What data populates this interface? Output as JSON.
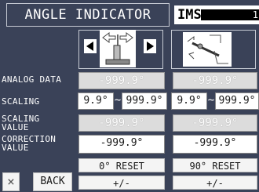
{
  "header": {
    "title": "ANGLE INDICATOR",
    "brand": "IMS",
    "brand_tail": "1"
  },
  "labels": {
    "analog_data": "ANALOG DATA",
    "scaling": "SCALING",
    "scaling_value_1": "SCALING",
    "scaling_value_2": "VALUE",
    "correction_value_1": "CORRECTION",
    "correction_value_2": "VALUE"
  },
  "left": {
    "analog_data": "-999.9°",
    "scaling_min": "9.9°",
    "scaling_sep": "~",
    "scaling_max": "999.9°",
    "scaling_value": "-999.9°",
    "correction_value": "-999.9°",
    "reset_label": "0° RESET",
    "sign_label": "+/-"
  },
  "right": {
    "analog_data": "-999.9°",
    "scaling_min": "9.9°",
    "scaling_sep": "~",
    "scaling_max": "999.9°",
    "scaling_value": "-999.9°",
    "correction_value": "-999.9°",
    "reset_label": "90° RESET",
    "sign_label": "+/-"
  },
  "footer": {
    "close_label": "×",
    "back_label": "BACK"
  }
}
